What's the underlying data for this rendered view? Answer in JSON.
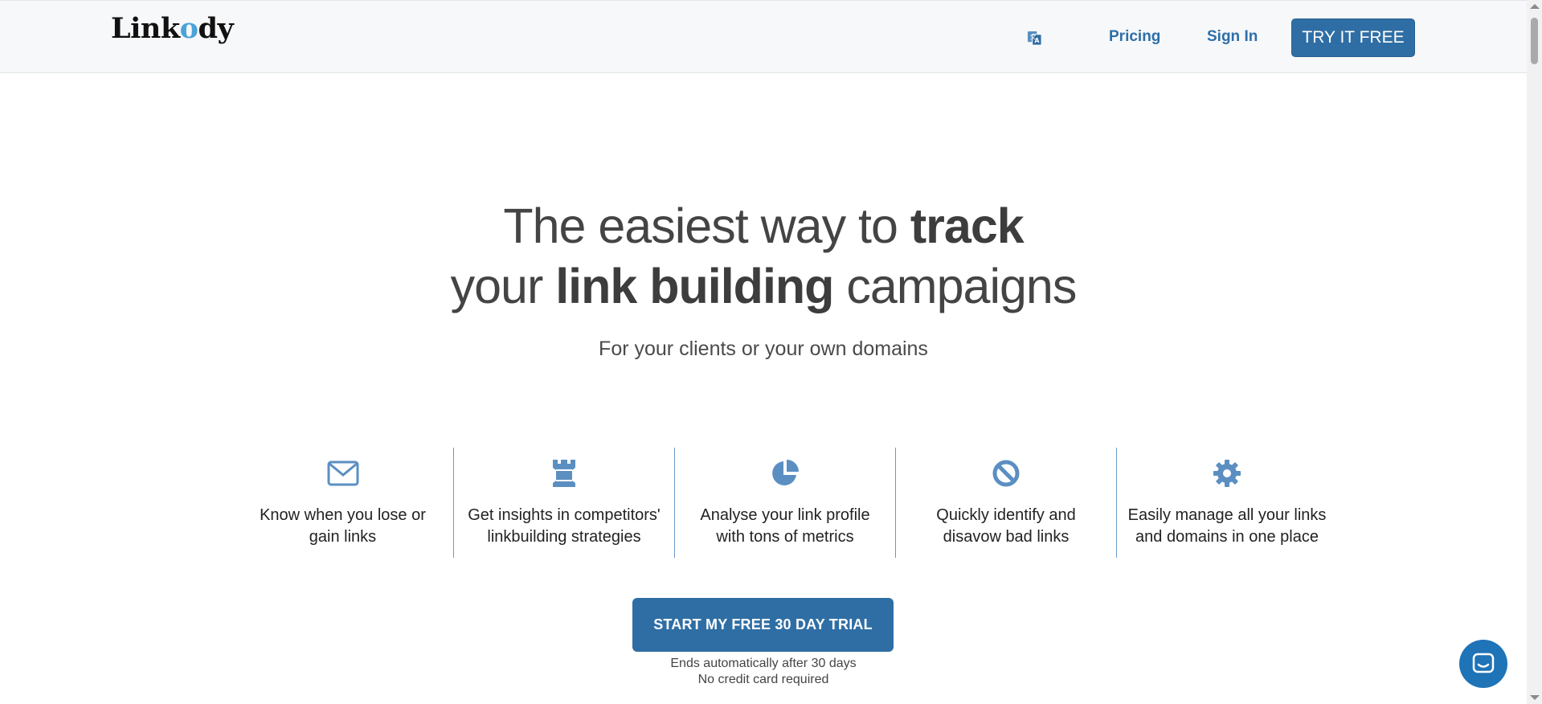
{
  "header": {
    "logo_text_pre": "Link",
    "logo_text_o": "o",
    "logo_text_post": "dy",
    "language_icon": "translate-icon",
    "nav": [
      {
        "label": "Pricing"
      },
      {
        "label": "Sign In"
      }
    ],
    "try_button": "TRY IT FREE"
  },
  "hero": {
    "title_line1_normal": "The easiest way to ",
    "title_line1_bold": "track",
    "title_line2_normal_a": "your ",
    "title_line2_bold": "link building",
    "title_line2_normal_b": " campaigns",
    "subtitle": "For your clients or your own domains"
  },
  "features": [
    {
      "icon": "envelope-icon",
      "line1": "Know when you lose or",
      "line2": "gain links"
    },
    {
      "icon": "rook-icon",
      "line1": "Get insights in competitors'",
      "line2": "linkbuilding strategies"
    },
    {
      "icon": "pie-chart-icon",
      "line1": "Analyse your link profile",
      "line2": "with tons of metrics"
    },
    {
      "icon": "ban-icon",
      "line1": "Quickly identify and",
      "line2": "disavow bad links"
    },
    {
      "icon": "gear-icon",
      "line1": "Easily manage all your links",
      "line2": "and domains in one place"
    }
  ],
  "cta": {
    "button": "START MY FREE 30 DAY TRIAL",
    "note1": "Ends automatically after 30 days",
    "note2": "No credit card required"
  },
  "chat": {
    "icon": "chat-icon"
  },
  "colors": {
    "accent": "#2f6ea4",
    "icon": "#5b8fc2",
    "chat": "#1f73b7"
  }
}
